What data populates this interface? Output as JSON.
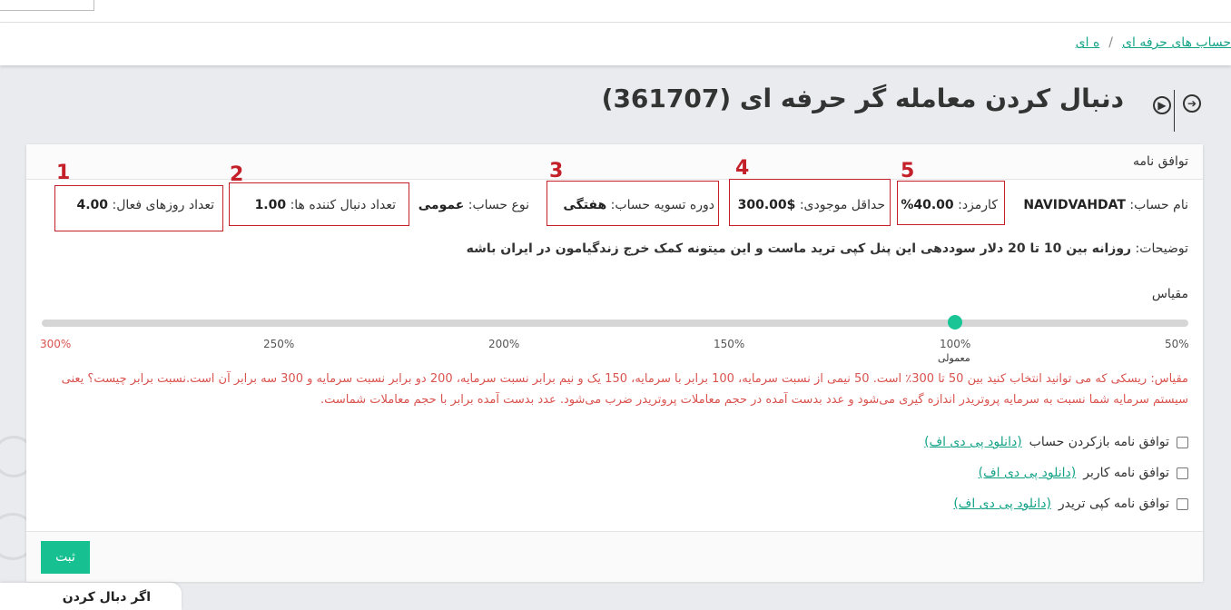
{
  "breadcrumb": {
    "partial": "ه ای",
    "separator": "/",
    "current": "حساب های حرفه ای"
  },
  "page": {
    "title": "دنبال کردن معامله گر حرفه ای (361707)"
  },
  "card": {
    "header": "توافق نامه",
    "account_name_label": "نام حساب:",
    "account_name_value": "NAVIDVAHDAT",
    "commission_label": "کارمزد:",
    "commission_value": "40.00%",
    "min_balance_label": "حداقل موجودی:",
    "min_balance_value": "$300.00",
    "settlement_label": "دوره تسویه حساب:",
    "settlement_value": "هفتگی",
    "account_type_label": "نوع حساب:",
    "account_type_value": "عمومی",
    "followers_label": "تعداد دنبال کننده ها:",
    "followers_value": "1.00",
    "active_days_label": "تعداد روزهای فعال:",
    "active_days_value": "4.00",
    "description_label": "توضیحات:",
    "description_value": "روزانه بین 10 تا 20 دلار سوددهی این پنل کپی ترید ماست و این میتونه کمک خرج زندگیامون در ایران باشه",
    "scale_label": "مقیاس",
    "scale_note": "مقیاس: ریسکی که می توانید انتخاب کنید بین 50 تا 300٪ است. 50 نیمی از نسبت سرمایه، 100 برابر با سرمایه، 150 یک و نیم برابر نسبت سرمایه، 200 دو برابر نسبت سرمایه و 300 سه برابر آن است.نسبت برابر چیست؟ یعنی سیستم سرمایه شما نسبت به سرمایه پروتریدر اندازه گیری می‌شود و عدد بدست آمده در حجم معاملات پروتریدر ضرب می‌شود. عدد بدست آمده برابر با حجم معاملات شماست."
  },
  "slider": {
    "ticks": [
      "50%",
      "100%",
      "150%",
      "200%",
      "250%",
      "300%"
    ],
    "normal_label": "معمولی",
    "selected": "100%"
  },
  "agreements": [
    {
      "label": "توافق نامه بازکردن حساب",
      "link": "(دانلود پی دی اف)"
    },
    {
      "label": "توافق نامه کاربر",
      "link": "(دانلود پی دی اف)"
    },
    {
      "label": "توافق نامه کپی تریدر",
      "link": "(دانلود پی دی اف)"
    }
  ],
  "markers": [
    "1",
    "2",
    "3",
    "4",
    "5"
  ],
  "submit_label": "ثبت",
  "bottom_tab": "اگر دبال کردن",
  "colors": {
    "accent": "#17c090",
    "link": "#15a388",
    "annotation_red": "#c4202a",
    "note_red": "#d9534f"
  }
}
